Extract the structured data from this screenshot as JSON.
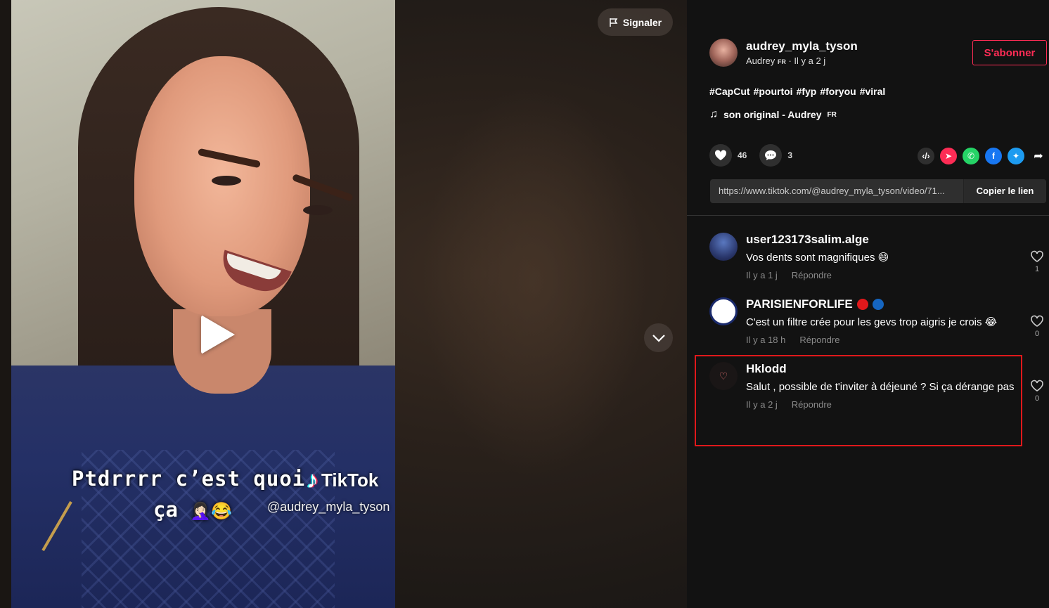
{
  "video": {
    "caption_line1": "Ptdrrrr c’est quoi",
    "caption_line2": "ça",
    "caption_emoji": "🤦🏻‍♀️😂",
    "watermark_brand": "TikTok",
    "watermark_handle": "@audrey_myla_tyson",
    "report_label": "Signaler"
  },
  "author": {
    "username": "audrey_myla_tyson",
    "display_name": "Audrey",
    "flag": "FR",
    "posted": " · Il y a 2 j",
    "follow_label": "S'abonner"
  },
  "hashtags": [
    "#CapCut",
    "#pourtoi",
    "#fyp",
    "#foryou",
    "#viral"
  ],
  "music": {
    "label": "son original - Audrey",
    "flag": "FR"
  },
  "stats": {
    "likes": "46",
    "comments": "3"
  },
  "share": {
    "url": "https://www.tiktok.com/@audrey_myla_tyson/video/71...",
    "copy_label": "Copier le lien",
    "icons": [
      "embed-icon",
      "send-icon",
      "whatsapp-icon",
      "facebook-icon",
      "twitter-icon",
      "share-arrow-icon"
    ],
    "colors": {
      "send": "#fe2c55",
      "whatsapp": "#25d366",
      "facebook": "#1877f2",
      "twitter": "#1d9bf0"
    }
  },
  "comments": [
    {
      "user": "user123173salim.alge",
      "text": "Vos dents sont magnifiques 😄",
      "time": "Il y a 1 j",
      "reply": "Répondre",
      "likes": "1"
    },
    {
      "user": "PARISIENFORLIFE",
      "text": "C'est un filtre crée pour les gevs trop aigris je crois 😂",
      "time": "Il y a 18 h",
      "reply": "Répondre",
      "likes": "0"
    },
    {
      "user": "Hklodd",
      "text": "Salut , possible de t'inviter à déjeuné ? Si ça dérange pas",
      "time": "Il y a 2 j",
      "reply": "Répondre",
      "likes": "0"
    }
  ],
  "colors": {
    "accent": "#fe2c55",
    "highlight": "#e0181b",
    "background": "#121212"
  }
}
